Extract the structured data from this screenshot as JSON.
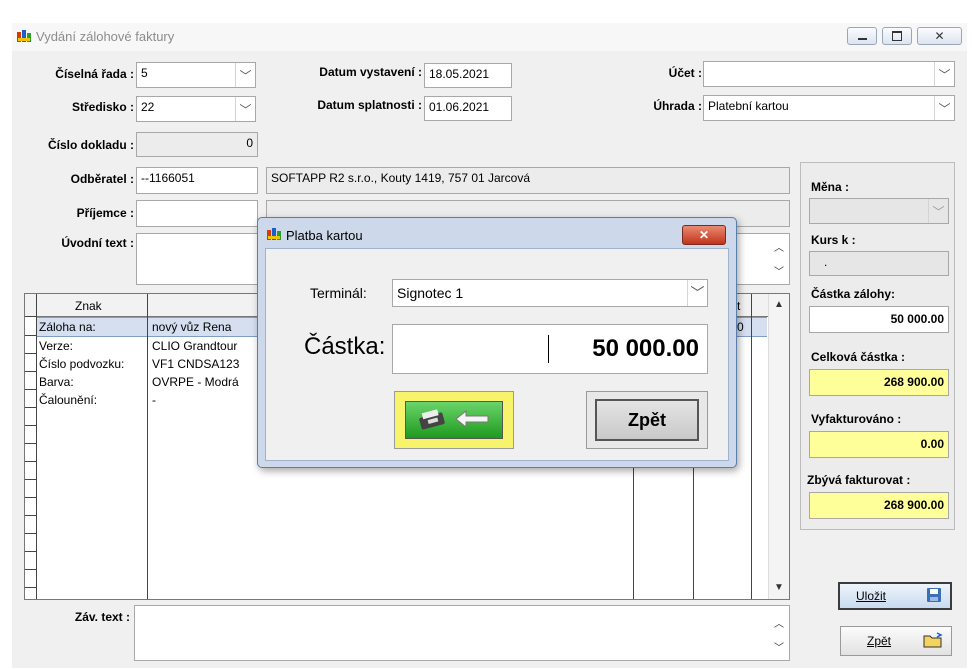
{
  "window": {
    "title": "Vydání zálohové faktury"
  },
  "header": {
    "ciselna_rada": {
      "label": "Číselná řada :",
      "value": "5"
    },
    "stredisko": {
      "label": "Středisko :",
      "value": "22"
    },
    "cislo_dokladu": {
      "label": "Číslo dokladu :",
      "value": "0"
    },
    "datum_vystaveni": {
      "label": "Datum vystavení :",
      "value": "18.05.2021"
    },
    "datum_splatnosti": {
      "label": "Datum splatnosti :",
      "value": "01.06.2021"
    },
    "ucet": {
      "label": "Účet :",
      "value": ""
    },
    "uhrada": {
      "label": "Úhrada :",
      "value": "Platební kartou"
    },
    "odberatel": {
      "label": "Odběratel :",
      "code": "--1166051",
      "name": "SOFTAPP R2 s.r.o., Kouty 1419, 757 01 Jarcová"
    },
    "prijemce": {
      "label": "Příjemce :",
      "value": ""
    },
    "uvodni_text": {
      "label": "Úvodní text :",
      "value": ""
    }
  },
  "grid": {
    "col_znak": "Znak",
    "col_t": "t",
    "row0_value": "0",
    "rows": [
      {
        "label": "Záloha na:",
        "value": "nový vůz Rena"
      },
      {
        "label": "Verze:",
        "value": "CLIO Grandtour"
      },
      {
        "label": "Číslo podvozku:",
        "value": "VF1 CNDSA123"
      },
      {
        "label": "Barva:",
        "value": "OVRPE - Modrá"
      },
      {
        "label": "Čalounění:",
        "value": "-"
      }
    ]
  },
  "footer": {
    "zav_text_label": "Záv. text :"
  },
  "right_panel": {
    "mena_label": "Měna :",
    "kurs_label": "Kurs  k :",
    "kurs_value": ".",
    "castka_zalohy_label": "Částka zálohy:",
    "castka_zalohy_value": "50 000.00",
    "celkova_castka_label": "Celková částka :",
    "celkova_castka_value": "268 900.00",
    "vyfakturovano_label": "Vyfakturováno :",
    "vyfakturovano_value": "0.00",
    "zbyva_fakturovat_label": "Zbývá fakturovat :",
    "zbyva_fakturovat_value": "268 900.00"
  },
  "buttons": {
    "ulozit": "Uložit",
    "zpet": "Zpět"
  },
  "dialog": {
    "title": "Platba kartou",
    "terminal_label": "Terminál:",
    "terminal_value": "Signotec 1",
    "castka_label": "Částka:",
    "castka_value": "50 000.00",
    "zpet_label": "Zpět"
  }
}
